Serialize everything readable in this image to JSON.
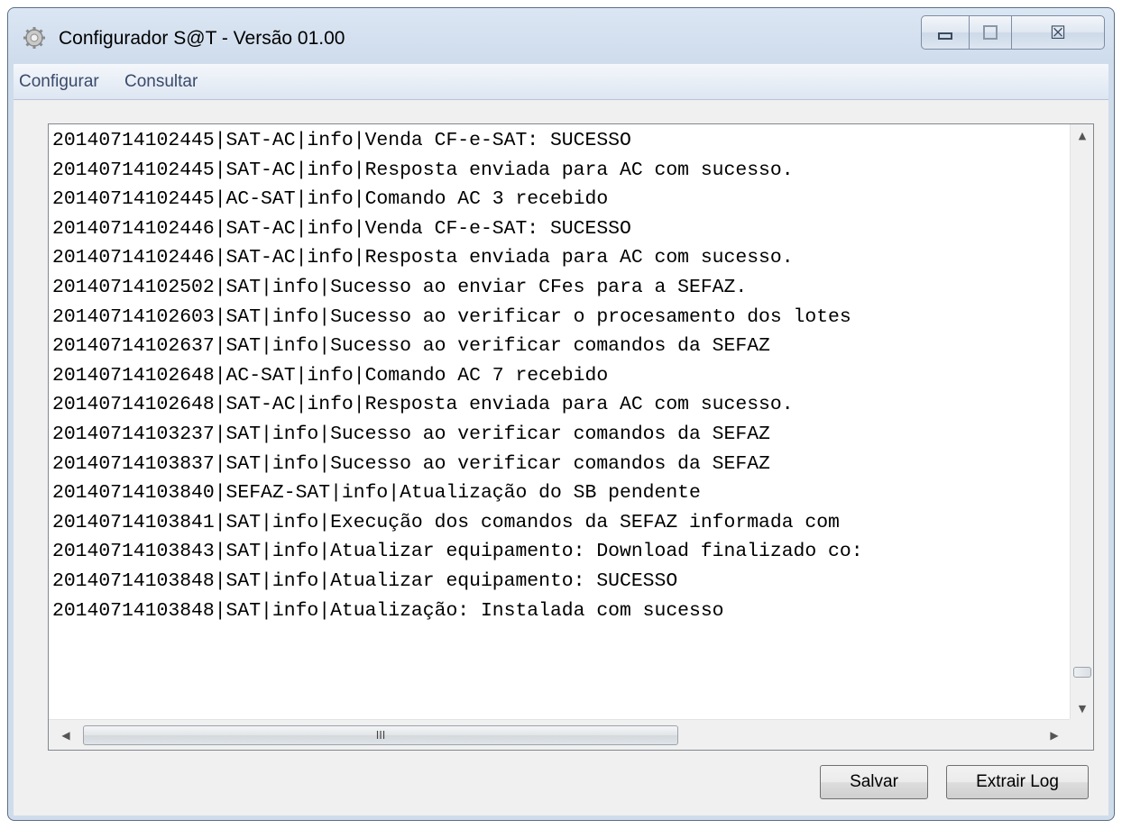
{
  "window": {
    "title": "Configurador S@T - Versão 01.00"
  },
  "caption_buttons": {
    "minimize_icon": "minimize-icon",
    "maximize_icon": "maximize-icon",
    "close_icon": "close-icon",
    "close_glyph": "☒"
  },
  "menu": {
    "items": [
      "Configurar",
      "Consultar"
    ]
  },
  "log": {
    "lines": [
      "20140714102445|SAT-AC|info|Venda CF-e-SAT: SUCESSO",
      "20140714102445|SAT-AC|info|Resposta enviada para AC com sucesso.",
      "20140714102445|AC-SAT|info|Comando AC 3 recebido",
      "20140714102446|SAT-AC|info|Venda CF-e-SAT: SUCESSO",
      "20140714102446|SAT-AC|info|Resposta enviada para AC com sucesso.",
      "20140714102502|SAT|info|Sucesso ao enviar CFes para a SEFAZ.",
      "20140714102603|SAT|info|Sucesso ao verificar o procesamento dos lotes",
      "20140714102637|SAT|info|Sucesso ao verificar comandos da SEFAZ",
      "20140714102648|AC-SAT|info|Comando AC 7 recebido",
      "20140714102648|SAT-AC|info|Resposta enviada para AC com sucesso.",
      "20140714103237|SAT|info|Sucesso ao verificar comandos da SEFAZ",
      "20140714103837|SAT|info|Sucesso ao verificar comandos da SEFAZ",
      "20140714103840|SEFAZ-SAT|info|Atualização do SB pendente",
      "20140714103841|SAT|info|Execução dos comandos da SEFAZ informada com",
      "20140714103843|SAT|info|Atualizar equipamento: Download finalizado co:",
      "20140714103848|SAT|info|Atualizar equipamento: SUCESSO",
      "20140714103848|SAT|info|Atualização: Instalada com sucesso"
    ]
  },
  "scrollbars": {
    "up_arrow": "▲",
    "down_arrow": "▼",
    "left_arrow": "◀",
    "right_arrow": "▶",
    "hthumb_grip": "III"
  },
  "buttons": {
    "save_label": "Salvar",
    "extract_label": "Extrair Log"
  }
}
